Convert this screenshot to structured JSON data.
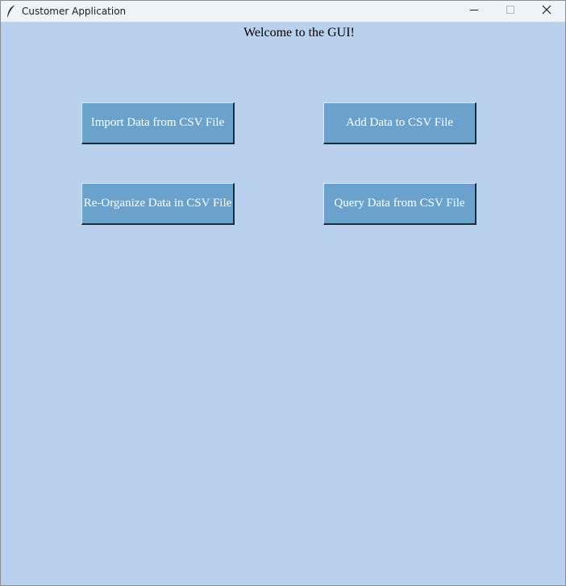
{
  "window": {
    "title": "Customer Application",
    "icon": "feather-icon",
    "controls": {
      "minimize": "minimize-icon",
      "maximize": "maximize-icon",
      "close": "close-icon"
    }
  },
  "main": {
    "welcome": "Welcome to the GUI!",
    "buttons": [
      {
        "label": "Import Data from CSV File"
      },
      {
        "label": "Add Data to CSV File"
      },
      {
        "label": "Re-Organize Data in CSV File"
      },
      {
        "label": "Query Data from CSV File"
      }
    ]
  },
  "colors": {
    "background": "#b9d1ec",
    "button": "#6aa2cb",
    "button_text": "#ffffff",
    "titlebar": "#eff4f9"
  }
}
